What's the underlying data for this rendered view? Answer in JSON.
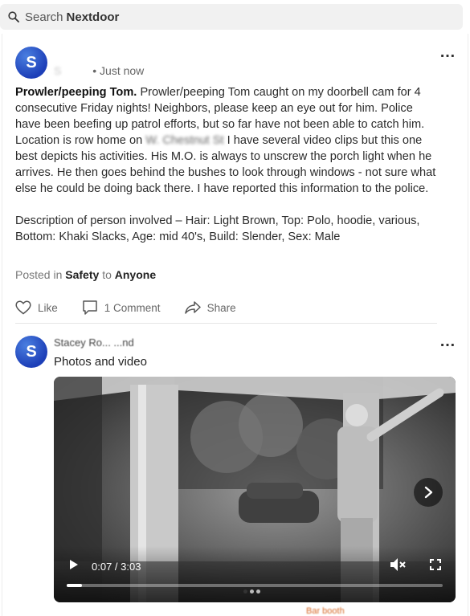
{
  "search": {
    "label": "Search",
    "brand": "Nextdoor"
  },
  "post": {
    "avatar_letter": "S",
    "author_redacted": "S",
    "timestamp": "• Just now",
    "title": "Prowler/peeping Tom.",
    "body_part1": "Prowler/peeping Tom caught on my doorbell cam for 4 consecutive Friday nights! Neighbors, please keep an eye out for him. Police have been beefing up patrol efforts, but so far have not been able to catch him. Location is row home on",
    "body_redacted": "W. Chestnut St",
    "body_part2": "I have several video clips but this one best depicts his activities. His M.O. is always to unscrew the porch light when he arrives. He then goes behind the bushes to look through windows - not sure what else he could be doing back there. I have reported this information to the police.",
    "description": "Description of person involved – Hair: Light Brown, Top: Polo, hoodie, various, Bottom: Khaki Slacks, Age: mid 40's, Build: Slender, Sex: Male",
    "posted_in_prefix": "Posted in",
    "category": "Safety",
    "to_word": "to",
    "audience": "Anyone",
    "like_label": "Like",
    "comment_count": "1",
    "comment_label": "Comment",
    "share_label": "Share"
  },
  "reply": {
    "avatar_letter": "S",
    "author": "Stacey Ro... ...nd",
    "caption": "Photos and video",
    "video": {
      "time_display": "0:07 / 3:03",
      "progress_fraction": 0.04,
      "slide_count": 3,
      "active_slide": 0
    },
    "cutoff_text": "Bar booth"
  },
  "colors": {
    "avatar": "#2a55d0",
    "accent_orange": "#d66b2a",
    "search_bg": "#f1f1f1"
  }
}
